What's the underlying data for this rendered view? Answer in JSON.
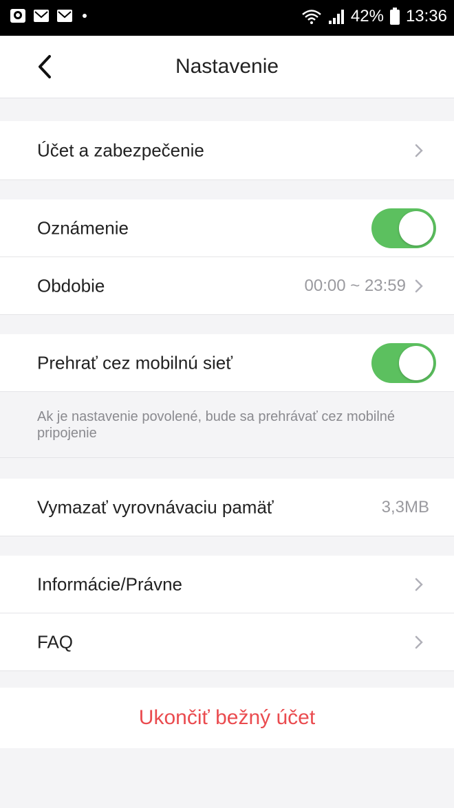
{
  "status_bar": {
    "battery": "42%",
    "time": "13:36",
    "icons": [
      "chat-icon",
      "mail-icon",
      "mail-icon",
      "wifi-icon",
      "signal-icon",
      "battery-icon"
    ]
  },
  "header": {
    "title": "Nastavenie",
    "back_icon": "chevron-left-icon"
  },
  "settings": {
    "account": {
      "label": "Účet a zabezpečenie"
    },
    "notification": {
      "label": "Oznámenie",
      "enabled": true
    },
    "period": {
      "label": "Obdobie",
      "value": "00:00 ~ 23:59"
    },
    "mobile_play": {
      "label": "Prehrať cez mobilnú sieť",
      "enabled": true,
      "note": "Ak je nastavenie povolené, bude sa prehrávať cez mobilné pripojenie"
    },
    "cache": {
      "label": "Vymazať vyrovnávaciu pamäť",
      "value": "3,3MB"
    },
    "info": {
      "label": "Informácie/Právne"
    },
    "faq": {
      "label": "FAQ"
    }
  },
  "logout": {
    "label": "Ukončiť bežný účet",
    "color": "#ea4b4f"
  },
  "colors": {
    "toggle_on": "#5cc05f",
    "background": "#f4f4f6"
  }
}
